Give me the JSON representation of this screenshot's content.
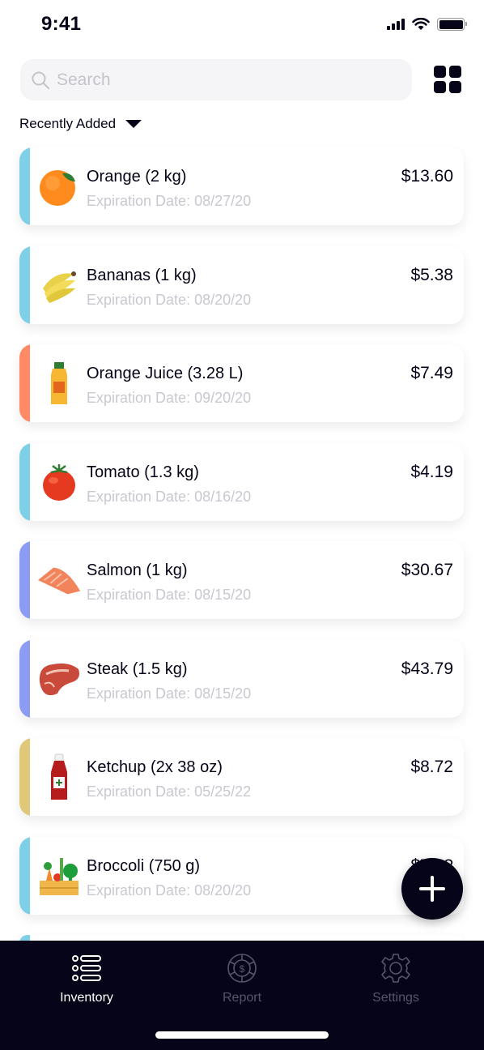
{
  "status_bar": {
    "time": "9:41"
  },
  "search": {
    "placeholder": "Search"
  },
  "sort": {
    "label": "Recently Added"
  },
  "items": [
    {
      "name": "Orange (2 kg)",
      "expiration": "Expiration Date: 08/27/20",
      "price": "$13.60",
      "accent": "#7ecfe8",
      "image": "orange"
    },
    {
      "name": "Bananas (1 kg)",
      "expiration": "Expiration Date: 08/20/20",
      "price": "$5.38",
      "accent": "#7ecfe8",
      "image": "bananas"
    },
    {
      "name": "Orange Juice (3.28 L)",
      "expiration": "Expiration Date: 09/20/20",
      "price": "$7.49",
      "accent": "#ff8a65",
      "image": "orange-juice"
    },
    {
      "name": "Tomato (1.3 kg)",
      "expiration": "Expiration Date: 08/16/20",
      "price": "$4.19",
      "accent": "#7ecfe8",
      "image": "tomato"
    },
    {
      "name": "Salmon (1 kg)",
      "expiration": "Expiration Date: 08/15/20",
      "price": "$30.67",
      "accent": "#8c9cf5",
      "image": "salmon"
    },
    {
      "name": "Steak (1.5 kg)",
      "expiration": "Expiration Date: 08/15/20",
      "price": "$43.79",
      "accent": "#8c9cf5",
      "image": "steak"
    },
    {
      "name": "Ketchup (2x 38 oz)",
      "expiration": "Expiration Date: 05/25/22",
      "price": "$8.72",
      "accent": "#e0c878",
      "image": "ketchup"
    },
    {
      "name": "Broccoli (750 g)",
      "expiration": "Expiration Date: 08/20/20",
      "price": "$7.??",
      "accent": "#7ecfe8",
      "image": "vegetables"
    }
  ],
  "fab": {
    "icon": "plus-icon"
  },
  "tabs": [
    {
      "label": "Inventory",
      "icon": "list-icon",
      "active": true
    },
    {
      "label": "Report",
      "icon": "dollar-chip-icon",
      "active": false
    },
    {
      "label": "Settings",
      "icon": "gear-icon",
      "active": false
    }
  ],
  "colors": {
    "dark": "#050418",
    "inactive_tab": "#56566a",
    "muted_text": "#c8c8d0"
  }
}
